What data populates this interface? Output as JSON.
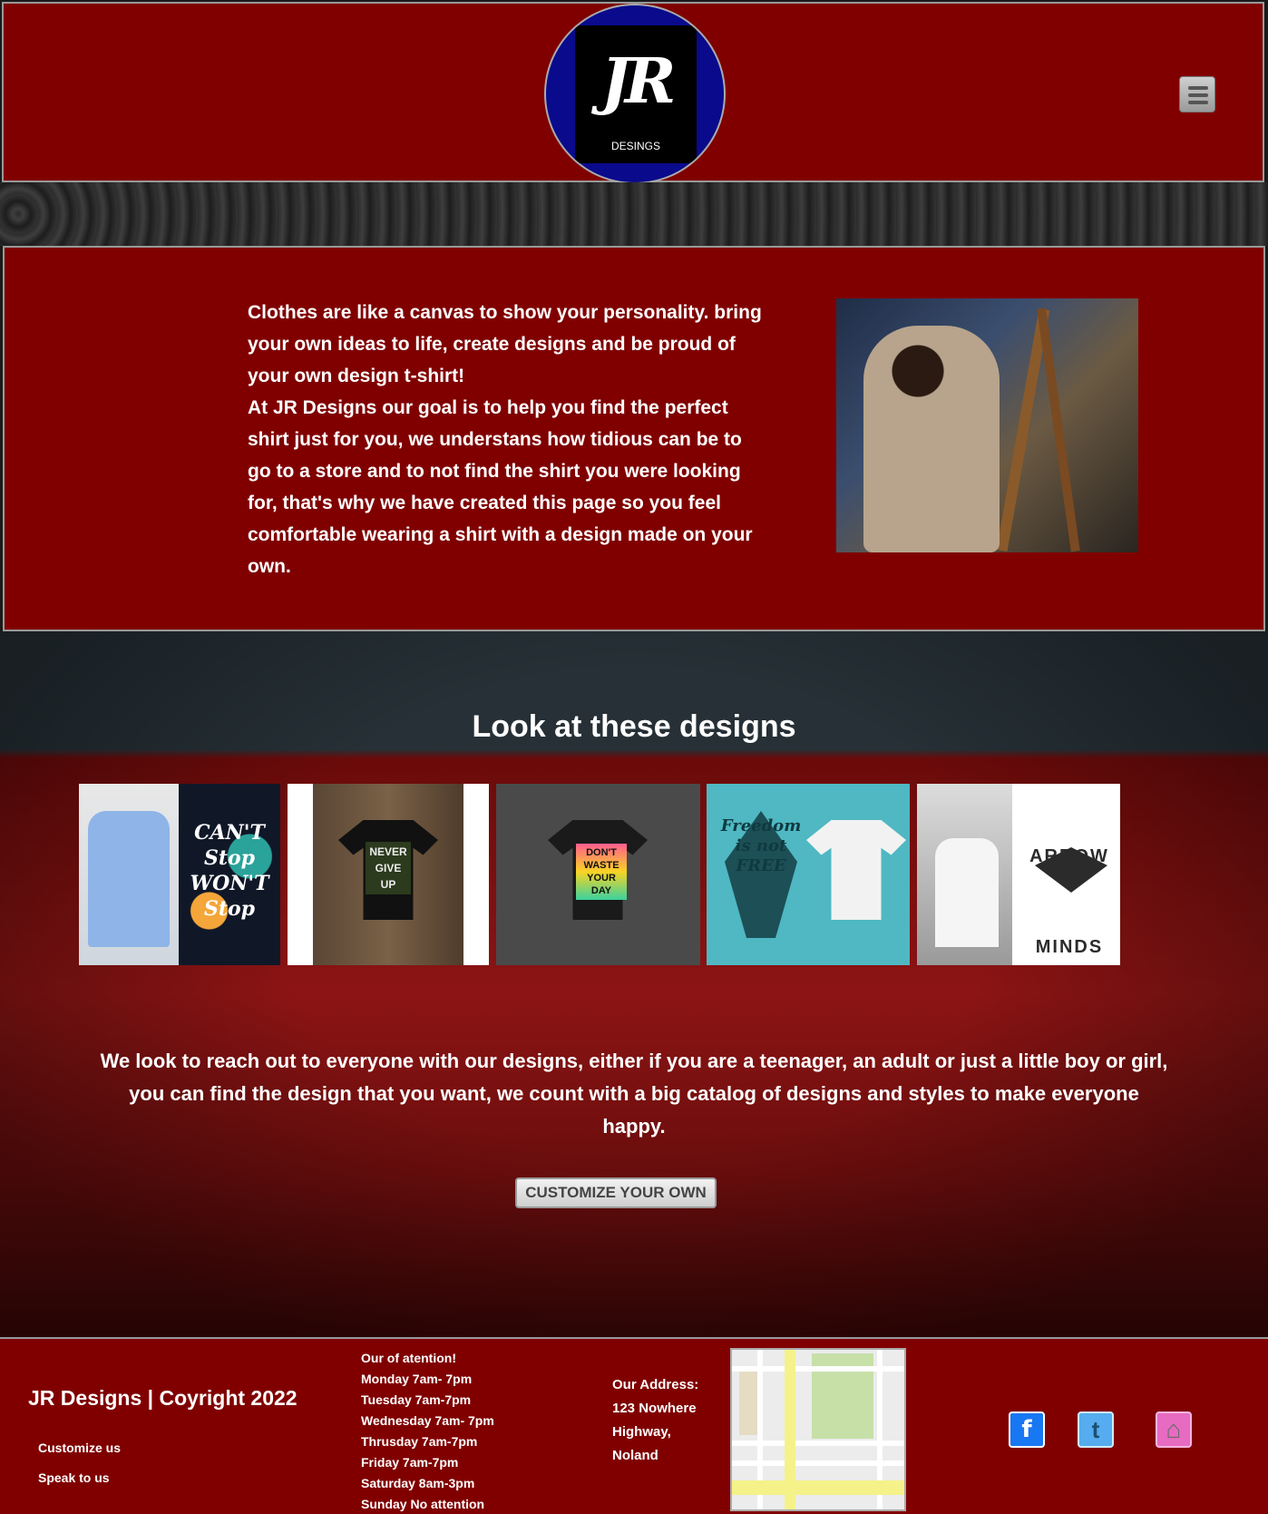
{
  "header": {
    "logo_mark": "JR",
    "logo_sub": "DESINGS",
    "menu_icon": "hamburger-menu-icon"
  },
  "intro": {
    "paragraph_1": "Clothes are like a canvas to show your personality. bring your own ideas to life, create designs and be proud of your own design t-shirt!",
    "paragraph_2": "At JR Designs our goal is to help you find the perfect shirt just for you, we understans how tidious can be to go to a store and to not find the shirt you were looking for, that's why we have created this page so you feel comfortable wearing a shirt with a design made on your own."
  },
  "designs": {
    "title": "Look at these designs",
    "cards": [
      {
        "text": "CAN'T Stop WON'T Stop"
      },
      {
        "text": "NEVER GIVE UP"
      },
      {
        "text": "DON'T WASTE YOUR DAY"
      },
      {
        "text": "Freedom is not FREE"
      },
      {
        "text": "ARROW MINDS"
      }
    ],
    "description": "We look to reach out to everyone with our designs, either if you are a teenager, an adult or just a little boy or girl, you can find the design that you want, we count with a big catalog of designs and styles to make everyone happy.",
    "button_label": "CUSTOMIZE YOUR OWN"
  },
  "footer": {
    "brand": "JR Designs | Coyright 2022",
    "links": [
      "Customize us",
      "Speak to us"
    ],
    "hours_title": "Our of atention!",
    "hours": [
      "Monday 7am- 7pm",
      "Tuesday 7am-7pm",
      "Wednesday 7am- 7pm",
      "Thrusday 7am-7pm",
      "Friday 7am-7pm",
      "Saturday 8am-3pm",
      "Sunday No attention"
    ],
    "address_title": "Our Address:",
    "address_line_1": "123 Nowhere",
    "address_line_2": "Highway,",
    "address_line_3": "Noland",
    "social": {
      "facebook": "f",
      "twitter": "t",
      "home": "⌂"
    }
  },
  "colors": {
    "brand_red": "#800000",
    "logo_blue": "#0a0a8c",
    "facebook": "#1877f2",
    "twitter": "#55acee",
    "home": "#e76bc1"
  }
}
